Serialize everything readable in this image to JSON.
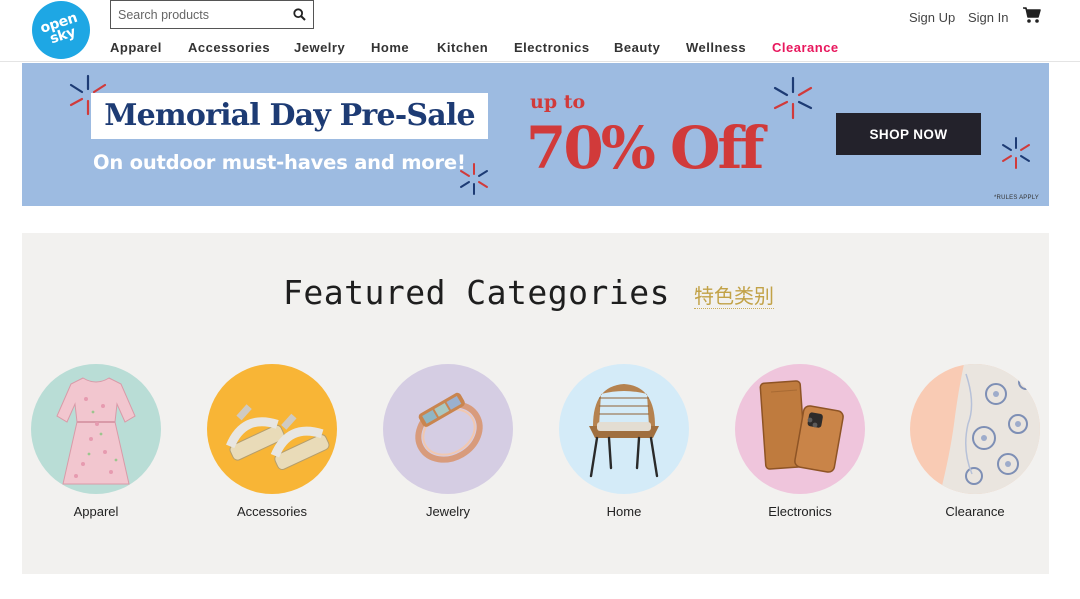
{
  "brand": {
    "logo_text": "open sky",
    "color": "#1ea7e4"
  },
  "search": {
    "placeholder": "Search products",
    "icon": "search-icon"
  },
  "nav": {
    "items": [
      {
        "label": "Apparel"
      },
      {
        "label": "Accessories"
      },
      {
        "label": "Jewelry"
      },
      {
        "label": "Home"
      },
      {
        "label": "Kitchen"
      },
      {
        "label": "Electronics"
      },
      {
        "label": "Beauty"
      },
      {
        "label": "Wellness"
      },
      {
        "label": "Clearance",
        "accent": true
      }
    ]
  },
  "account": {
    "sign_up": "Sign Up",
    "sign_in": "Sign In",
    "cart_icon": "cart-icon"
  },
  "promo": {
    "title": "Memorial Day Pre-Sale",
    "subtitle": "On outdoor must-haves and more!",
    "upto": "up to",
    "discount": "70% Off",
    "button": "SHOP NOW",
    "fineprint": "*RULES APPLY",
    "colors": {
      "background": "#9dbbe1",
      "title": "#1d3b74",
      "discount": "#d13a3a",
      "button": "#23222b"
    }
  },
  "featured": {
    "title": "Featured Categories",
    "title_translation": "特色类别",
    "categories": [
      {
        "label": "Apparel",
        "bg": "#b9ddd6",
        "icon": "dress-icon"
      },
      {
        "label": "Accessories",
        "bg": "#f8b536",
        "icon": "sandals-icon"
      },
      {
        "label": "Jewelry",
        "bg": "#d5cde3",
        "icon": "ring-icon"
      },
      {
        "label": "Home",
        "bg": "#d4ebf8",
        "icon": "chair-icon"
      },
      {
        "label": "Electronics",
        "bg": "#efc5dc",
        "icon": "phone-case-icon"
      },
      {
        "label": "Clearance",
        "bg": "#f9cbb4",
        "icon": "scarf-icon"
      }
    ]
  }
}
